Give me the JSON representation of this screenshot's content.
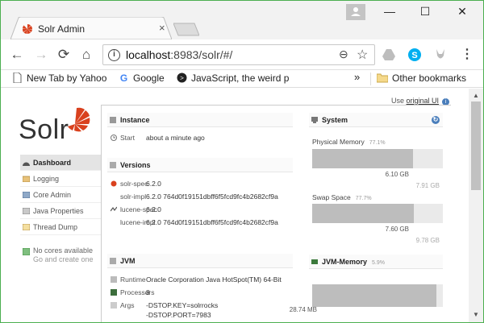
{
  "browser": {
    "tab_title": "Solr Admin",
    "tab_close": "×",
    "window": {
      "minimize": "—",
      "maximize": "☐",
      "close": "✕"
    },
    "nav": {
      "back": "←",
      "forward": "→",
      "reload": "⟳",
      "home": "⌂"
    },
    "url_host": "localhost",
    "url_rest": ":8983/solr/#/",
    "zoom_glyph": "⊖",
    "star_glyph": "☆",
    "menu_glyph": "⋮",
    "bookmarks": [
      {
        "label": "New Tab by Yahoo",
        "icon": "page-icon"
      },
      {
        "label": "Google",
        "icon": "google-icon"
      },
      {
        "label": "JavaScript, the weird p",
        "icon": "terminal-icon"
      }
    ],
    "bookmarks_overflow": "»",
    "other_bookmarks": "Other bookmarks"
  },
  "solr": {
    "use_original_prefix": "Use",
    "use_original_link": "original UI",
    "use_original_help": "i",
    "logo_text": "Solr",
    "sidebar": [
      {
        "label": "Dashboard",
        "icon": "dashboard-icon",
        "active": true
      },
      {
        "label": "Logging",
        "icon": "logging-icon",
        "active": false
      },
      {
        "label": "Core Admin",
        "icon": "core-admin-icon",
        "active": false
      },
      {
        "label": "Java Properties",
        "icon": "java-properties-icon",
        "active": false
      },
      {
        "label": "Thread Dump",
        "icon": "thread-dump-icon",
        "active": false
      }
    ],
    "no_cores": "No cores available",
    "no_cores_sub": "Go and create one",
    "instance": {
      "title": "Instance",
      "start_label": "Start",
      "start_value": "about a minute ago"
    },
    "versions": {
      "title": "Versions",
      "rows": [
        {
          "label": "solr-spec",
          "value": "6.2.0"
        },
        {
          "label": "solr-impl",
          "value": "6.2.0 764d0f19151dbff6f5fcd9fc4b2682cf9a"
        },
        {
          "label": "lucene-spec",
          "value": "6.2.0"
        },
        {
          "label": "lucene-impl",
          "value": "6.2.0 764d0f19151dbff6f5fcd9fc4b2682cf9a"
        }
      ]
    },
    "jvm": {
      "title": "JVM",
      "runtime_label": "Runtime",
      "runtime_value": "Oracle Corporation Java HotSpot(TM) 64-Bit",
      "processors_label": "Processors",
      "processors_value": "8",
      "args_label": "Args",
      "args_values": [
        "-DSTOP.KEY=solrrocks",
        "-DSTOP.PORT=7983"
      ]
    },
    "system": {
      "title": "System",
      "refresh_glyph": "↻",
      "physical": {
        "label": "Physical Memory",
        "percent": "77.1%",
        "used": "6.10 GB",
        "total": "7.91 GB",
        "fraction": 0.771
      },
      "swap": {
        "label": "Swap Space",
        "percent": "77.7%",
        "used": "7.60 GB",
        "total": "9.78 GB",
        "fraction": 0.777
      }
    },
    "jvm_memory": {
      "title": "JVM-Memory",
      "percent": "5.9%",
      "used": "28.74 MB",
      "fraction": 0.95
    }
  },
  "colors": {
    "solr_orange": "#d9411e",
    "accent_blue": "#4a7ebb",
    "bar_fill": "#bdbdbd"
  }
}
